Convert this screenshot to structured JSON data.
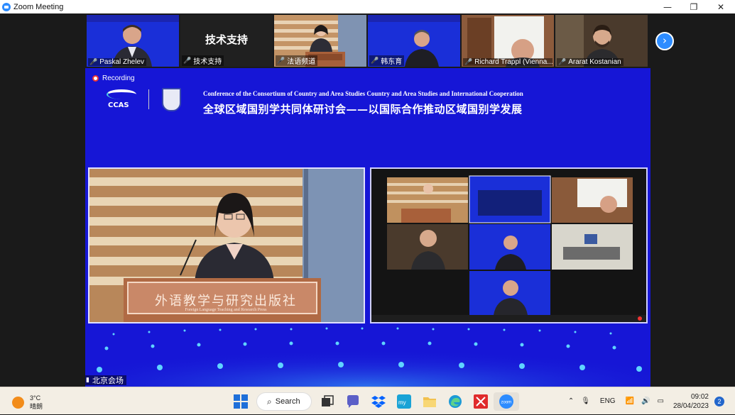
{
  "window": {
    "title": "Zoom Meeting",
    "minimize_glyph": "—",
    "restore_glyph": "❐",
    "close_glyph": "✕"
  },
  "participants": [
    {
      "name": "Paskal Zhelev",
      "muted": true
    },
    {
      "name": "技术支持",
      "muted": true,
      "display_text": "技术支持"
    },
    {
      "name": "法语频道",
      "muted": true
    },
    {
      "name": "韩东育",
      "muted": true
    },
    {
      "name": "Richard Trappl (Vienna...",
      "muted": true
    },
    {
      "name": "Ararat Kostanian",
      "muted": true
    }
  ],
  "next_page_icon": "chevron-right-icon",
  "recording": {
    "label": "Recording"
  },
  "banner": {
    "logo_text": "CCAS",
    "title_en": "Conference of the Consortium of Country and Area Studies Country and Area Studies and International Cooperation",
    "title_zh": "全球区域国别学共同体研讨会——以国际合作推动区域国别学发展"
  },
  "speaker_view": {
    "podium_text": "外语教学与研究出版社",
    "podium_subtext": "Foreign Language Teaching and Research Press",
    "site_label": "北京会场"
  },
  "taskbar": {
    "weather_temp": "3°C",
    "weather_desc": "晴朗",
    "search_label": "Search",
    "language": "ENG",
    "time": "09:02",
    "date": "28/04/2023",
    "notification_count": "2"
  },
  "colors": {
    "zoom_blue": "#2d8cff",
    "banner_blue": "#1616d6",
    "muted_red": "#e02828"
  }
}
